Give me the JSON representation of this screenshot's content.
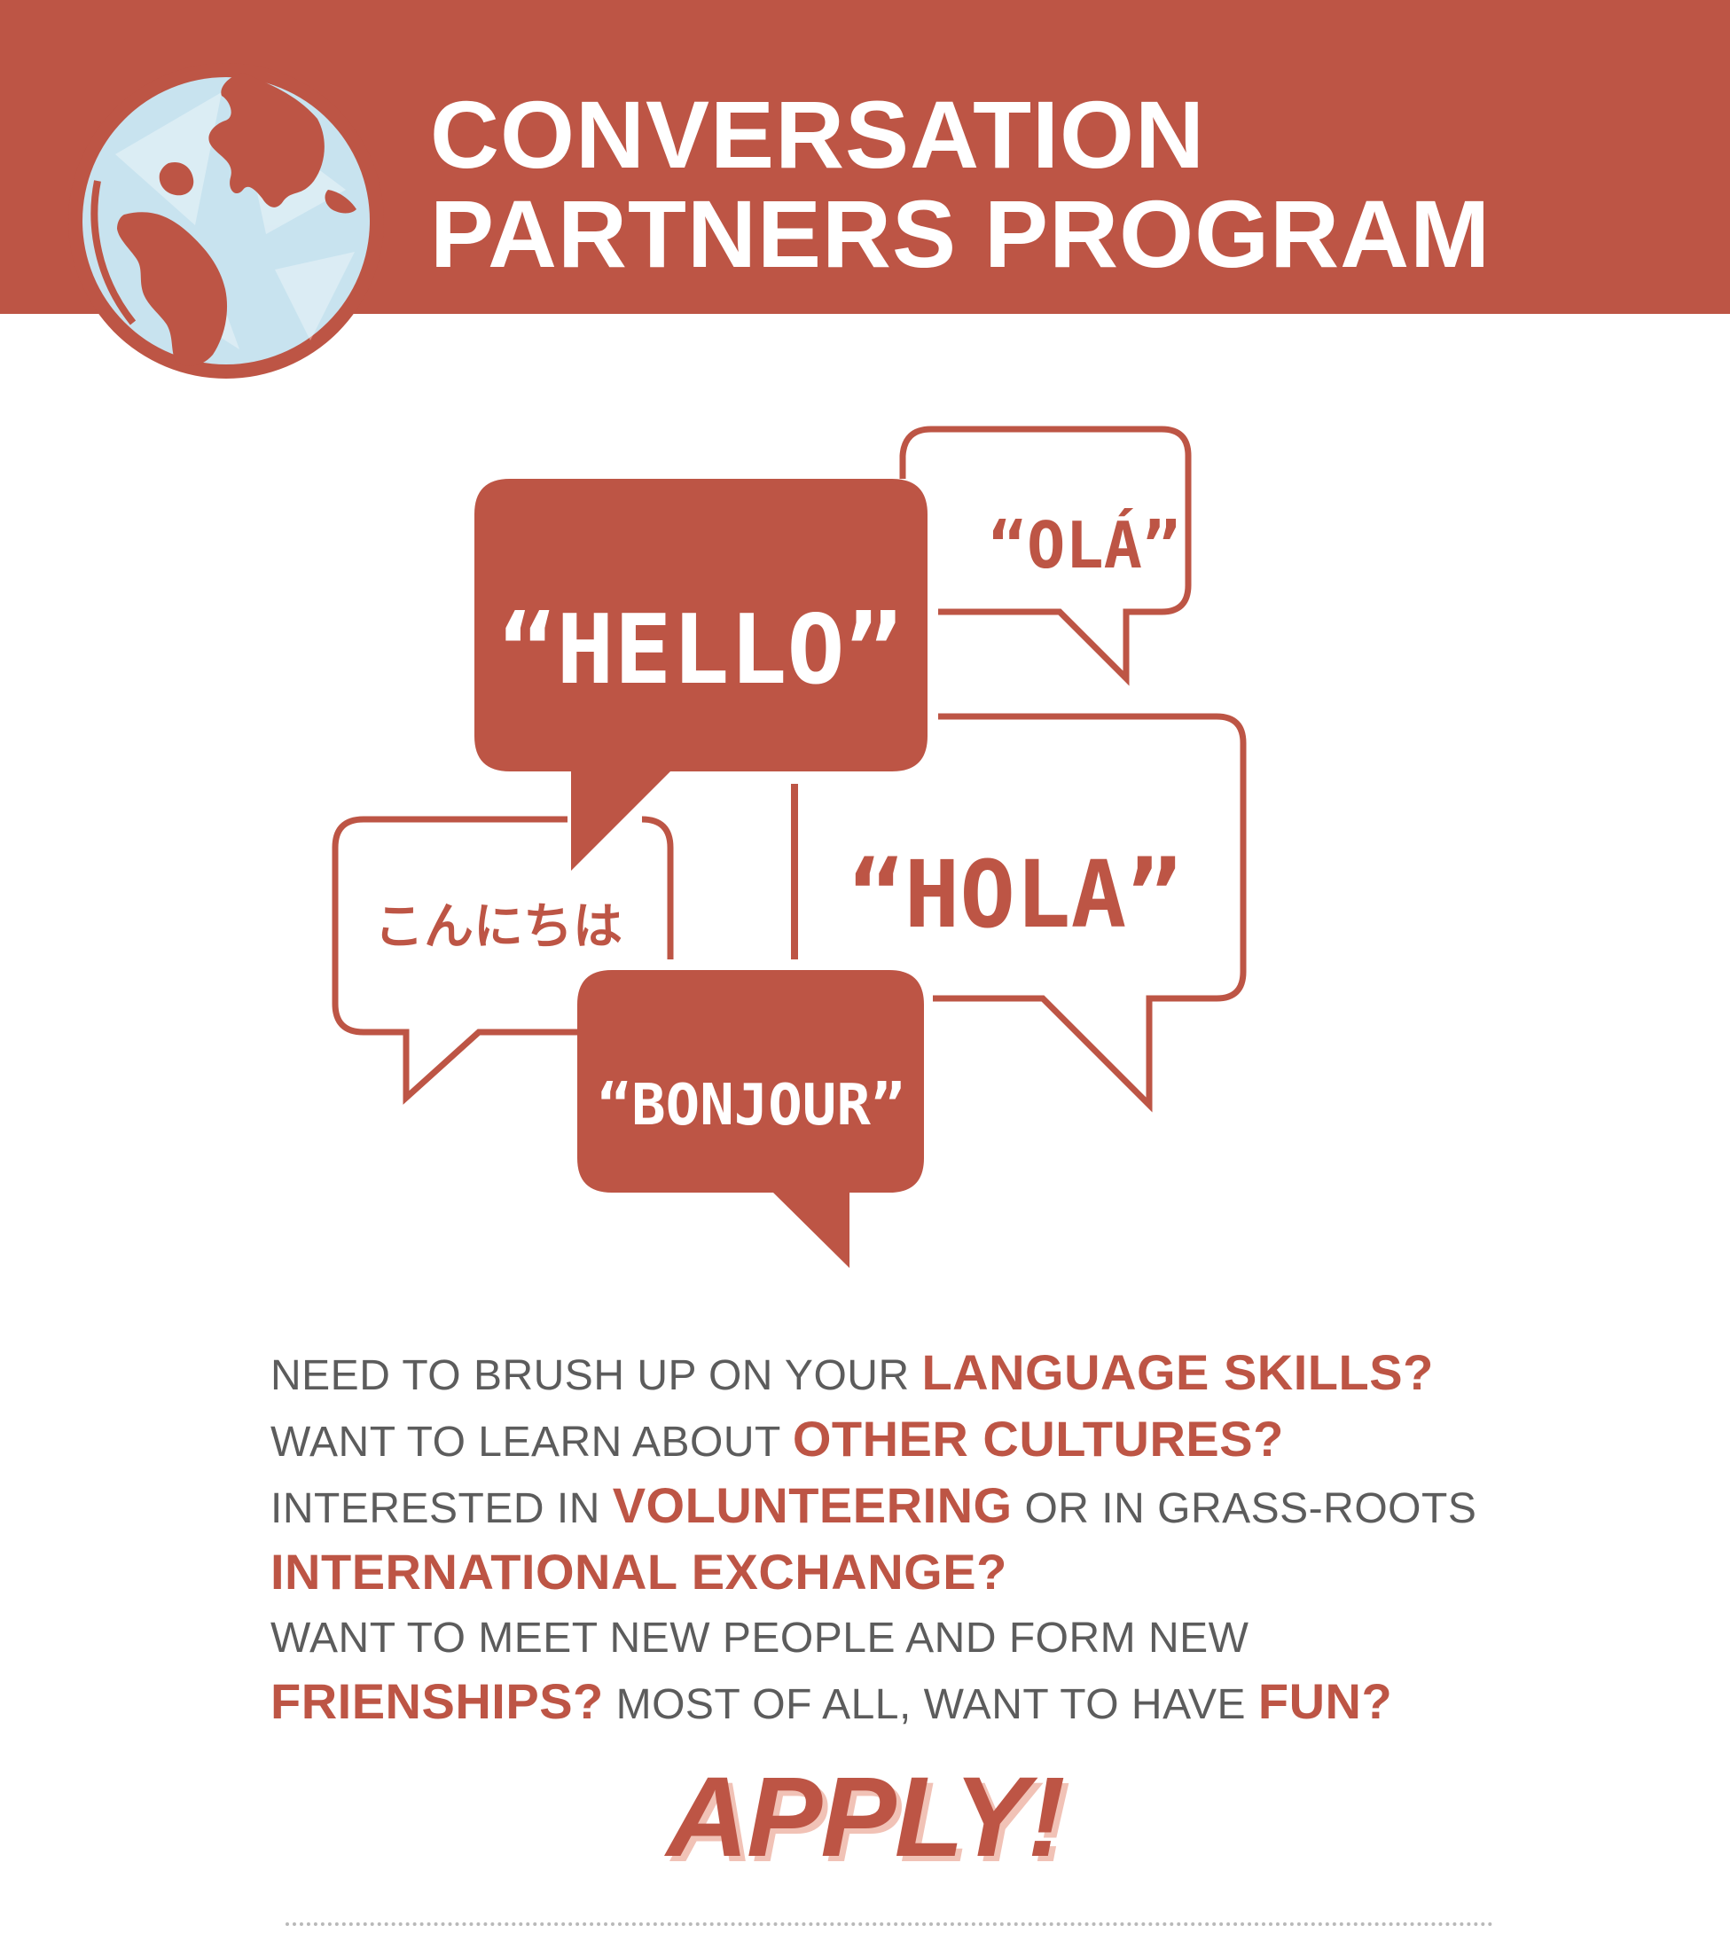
{
  "header": {
    "title_line1": "CONVERSATION",
    "title_line2": "PARTNERS PROGRAM",
    "globe_icon": "globe-icon"
  },
  "bubbles": {
    "hello": "“HELLO”",
    "ola": "“OLÁ”",
    "hola": "“HOLA”",
    "konnichiwa": "こんにちは",
    "bonjour": "“BONJOUR”"
  },
  "copy": {
    "l1_a": "NEED TO BRUSH UP ON YOUR ",
    "l1_b": "LANGUAGE SKILLS?",
    "l2_a": "WANT TO LEARN ABOUT ",
    "l2_b": "OTHER CULTURES?",
    "l3_a": "INTERESTED IN ",
    "l3_b": "VOLUNTEERING",
    "l3_c": " OR IN GRASS-ROOTS",
    "l4_a": "INTERNATIONAL EXCHANGE?",
    "l5_a": "WANT TO MEET NEW PEOPLE AND FORM NEW",
    "l6_a": "FRIENSHIPS?",
    "l6_b": " MOST OF ALL, WANT TO HAVE ",
    "l6_c": "FUN?"
  },
  "cta": {
    "apply": "APPLY!"
  },
  "colors": {
    "brand_red": "#bd5545",
    "globe_blue": "#c8e3ef",
    "body_gray": "#5c5c5c",
    "apply_shadow": "#f1c2b6"
  }
}
